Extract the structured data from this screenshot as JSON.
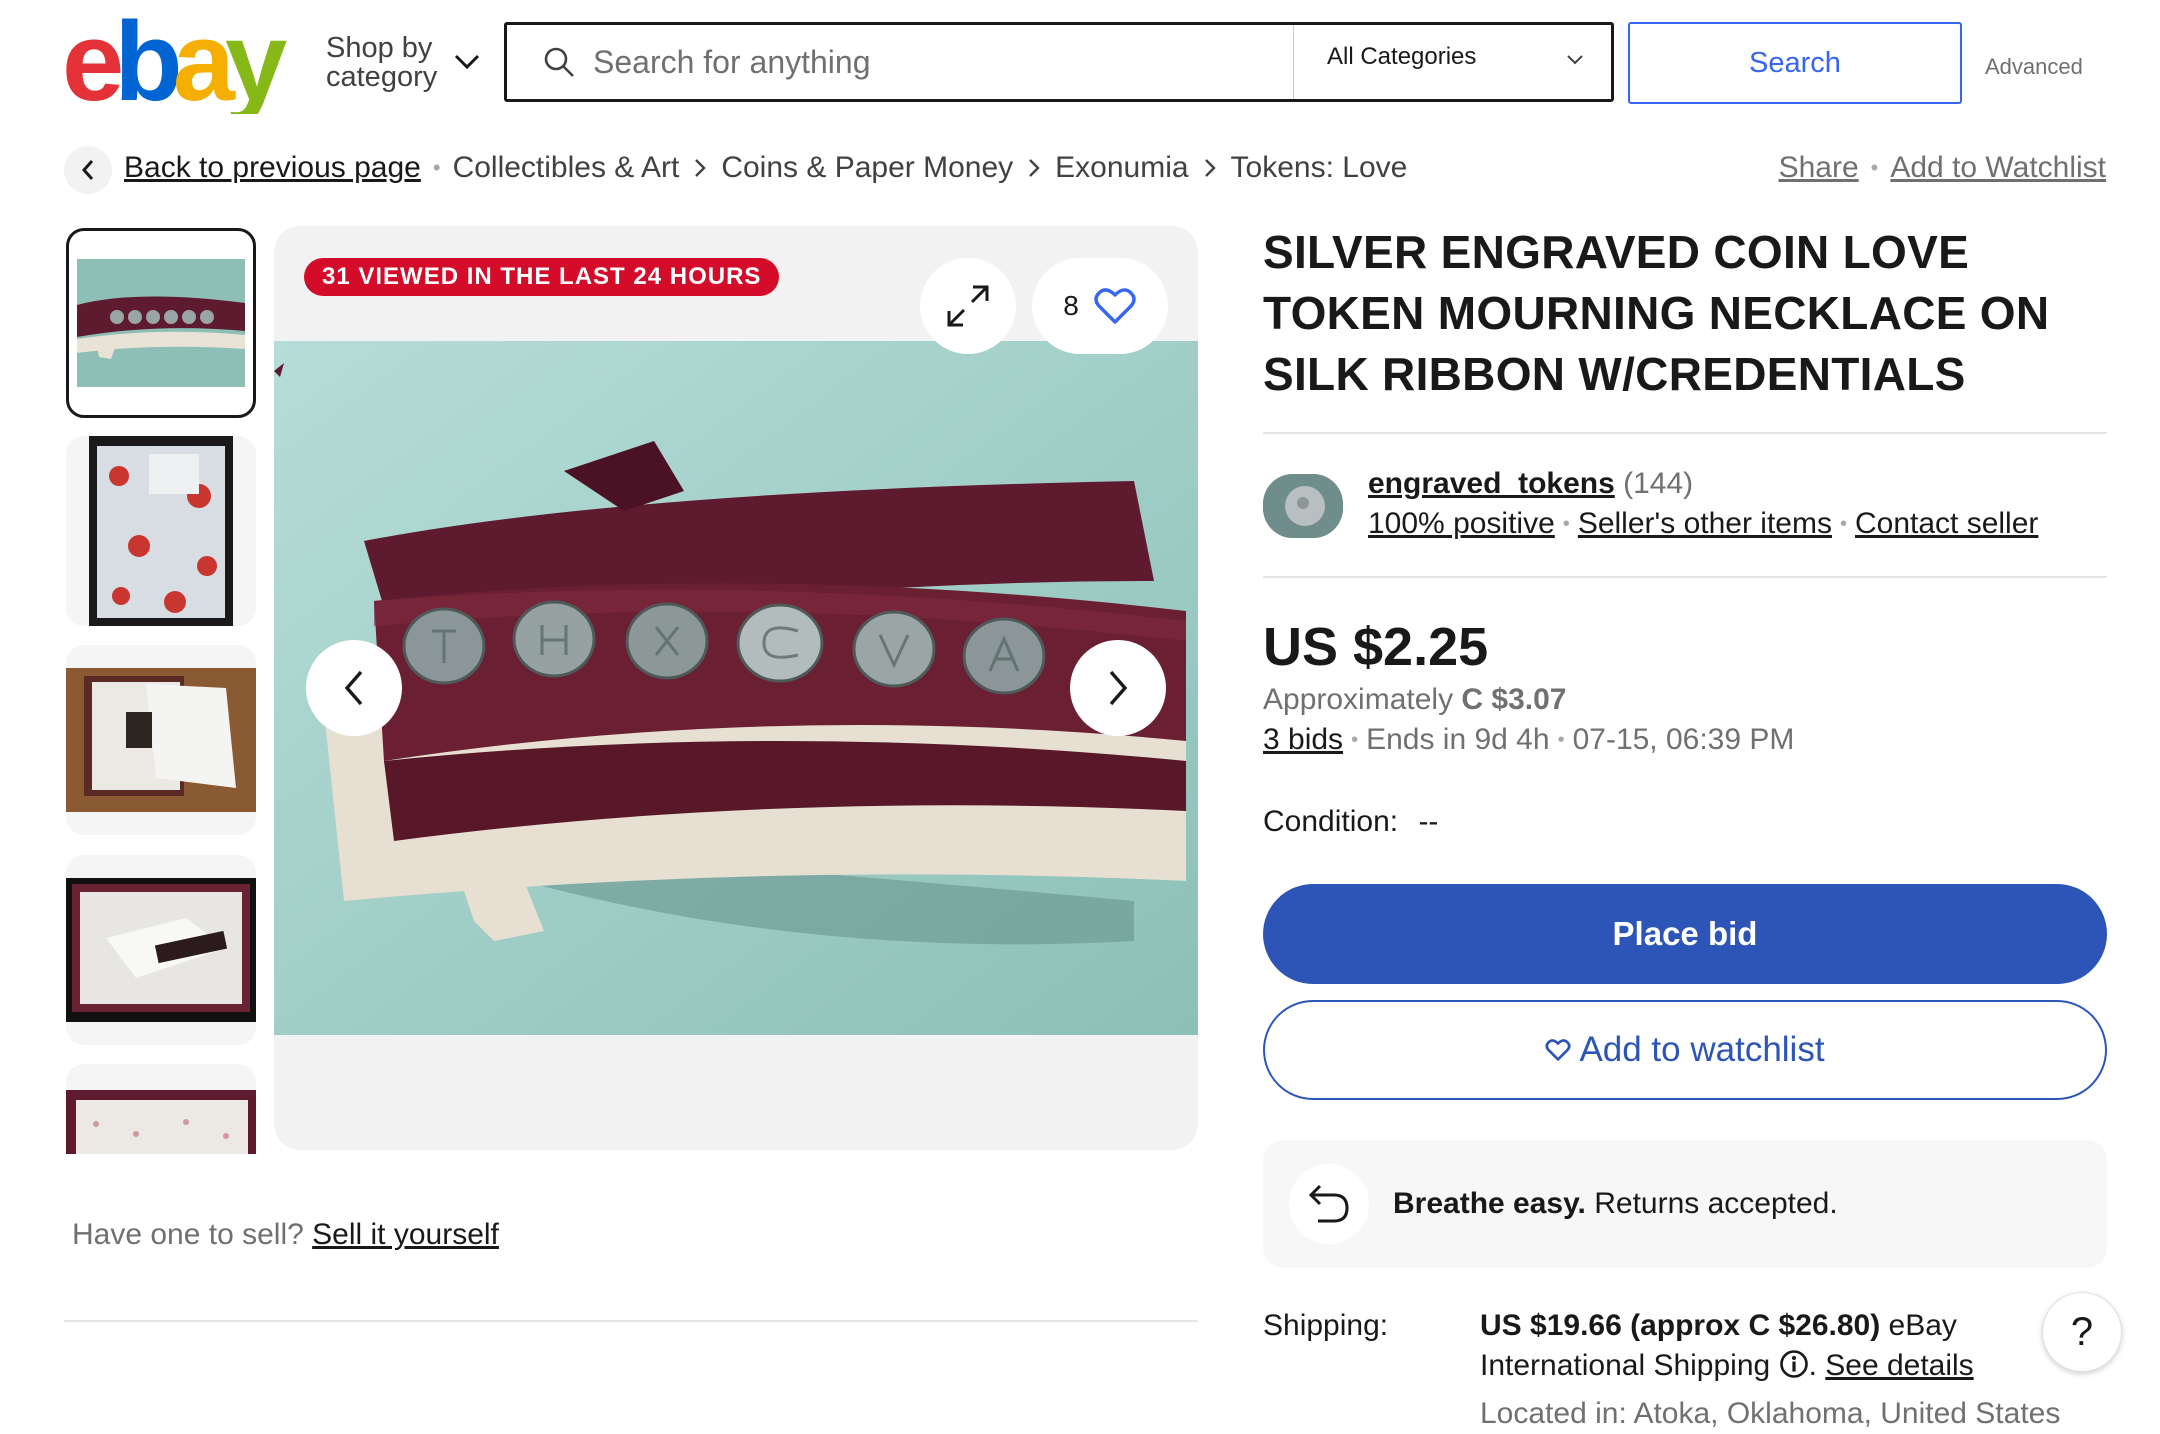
{
  "header": {
    "logo_letters": [
      "e",
      "b",
      "a",
      "y"
    ],
    "logo_colors": [
      "#e53238",
      "#0064d2",
      "#f5af02",
      "#86b817"
    ],
    "shop_by_line1": "Shop by",
    "shop_by_line2": "category",
    "search_placeholder": "Search for anything",
    "category_selected": "All Categories",
    "search_button": "Search",
    "advanced_link": "Advanced"
  },
  "breadcrumb": {
    "back": "Back to previous page",
    "items": [
      "Collectibles & Art",
      "Coins & Paper Money",
      "Exonumia",
      "Tokens: Love"
    ],
    "share": "Share",
    "watchlist": "Add to Watchlist"
  },
  "gallery": {
    "viewed_badge": "31 VIEWED IN THE LAST 24 HOURS",
    "watch_count": "8",
    "thumbnail_count": 5
  },
  "sell": {
    "prompt": "Have one to sell?",
    "link": "Sell it yourself"
  },
  "item": {
    "title": "SILVER ENGRAVED COIN LOVE TOKEN MOURNING NECKLACE ON SILK RIBBON W/CREDENTIALS"
  },
  "seller": {
    "name": "engraved_tokens",
    "feedback_count": "(144)",
    "positive": "100% positive",
    "other_items": "Seller's other items",
    "contact": "Contact seller"
  },
  "pricing": {
    "price": "US $2.25",
    "approx_label": "Approximately",
    "approx_value": "C $3.07",
    "bids": "3 bids",
    "ends_in": "Ends in 9d 4h",
    "end_date": "07-15, 06:39 PM",
    "condition_label": "Condition:",
    "condition_value": "--"
  },
  "actions": {
    "place_bid": "Place bid",
    "add_watchlist": "Add to watchlist"
  },
  "returns": {
    "bold": "Breathe easy.",
    "text": "Returns accepted."
  },
  "shipping": {
    "label": "Shipping:",
    "price": "US $19.66 (approx C $26.80)",
    "service": "eBay International Shipping",
    "see_details": "See details",
    "location": "Located in: Atoka, Oklahoma, United States"
  },
  "help": {
    "label": "?"
  },
  "colors": {
    "accent_blue": "#3665f3",
    "button_blue": "#2d55b8",
    "badge_red": "#d50b2a",
    "ribbon": "#5e1a2e"
  }
}
